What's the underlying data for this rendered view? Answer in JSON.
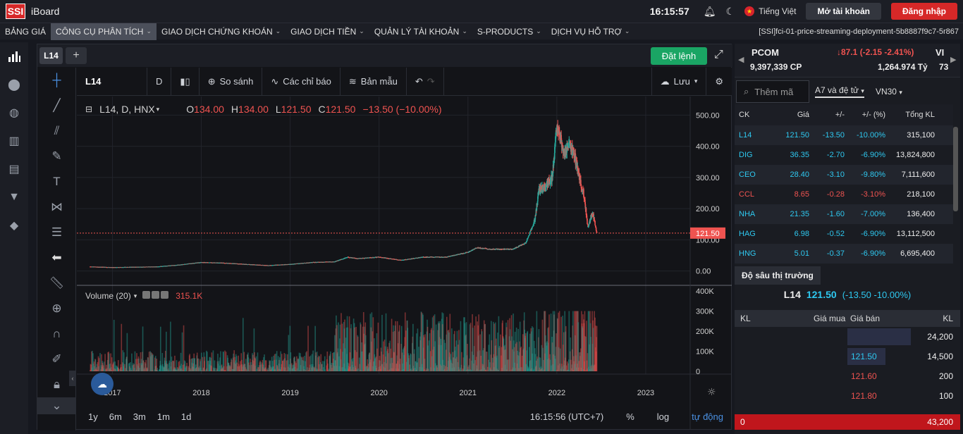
{
  "app": {
    "logo": "SSI",
    "name": "iBoard"
  },
  "header": {
    "time": "16:15:57",
    "language": "Tiếng Việt",
    "open_account": "Mở tài khoản",
    "login": "Đăng nhập"
  },
  "menu": {
    "items": [
      {
        "label": "BẢNG GIÁ",
        "chevron": false,
        "active": false
      },
      {
        "label": "CÔNG CỤ PHÂN TÍCH",
        "chevron": true,
        "active": true
      },
      {
        "label": "GIAO DỊCH CHỨNG KHOÁN",
        "chevron": true,
        "active": false
      },
      {
        "label": "GIAO DỊCH TIỀN",
        "chevron": true,
        "active": false
      },
      {
        "label": "QUẢN LÝ TÀI KHOẢN",
        "chevron": true,
        "active": false
      },
      {
        "label": "S-PRODUCTS",
        "chevron": true,
        "active": false
      },
      {
        "label": "DỊCH VỤ HỖ TRỢ",
        "chevron": true,
        "active": false
      }
    ],
    "deployment": "[SSI]fci-01-price-streaming-deployment-5b8887f9c7-5r867"
  },
  "chart_tab": {
    "symbol": "L14",
    "order_button": "Đặt lệnh"
  },
  "chart_toolbar": {
    "symbol": "L14",
    "interval": "D",
    "compare": "So sánh",
    "indicators": "Các chỉ báo",
    "templates": "Bản mẫu",
    "save": "Lưu"
  },
  "legend": {
    "title": "L14, D, HNX",
    "open_label": "O",
    "open": "134.00",
    "high_label": "H",
    "high": "134.00",
    "low_label": "L",
    "low": "121.50",
    "close_label": "C",
    "close": "121.50",
    "change": "−13.50 (−10.00%)"
  },
  "volume_legend": {
    "label": "Volume (20)",
    "value": "315.1K"
  },
  "bottom_bar": {
    "ranges": [
      "1y",
      "6m",
      "3m",
      "1m",
      "1d"
    ],
    "time": "16:15:56 (UTC+7)",
    "percent": "%",
    "log": "log",
    "auto": "tự động"
  },
  "colors": {
    "up": "#26a69a",
    "down": "#ef5350",
    "accent": "#1aa564",
    "brand": "#d62828",
    "blue": "#2ec8f0"
  },
  "chart_data": {
    "type": "candlestick",
    "symbol": "L14",
    "x_ticks": [
      "2017",
      "2018",
      "2019",
      "2020",
      "2021",
      "2022",
      "2023"
    ],
    "price_ticks": [
      "500.00",
      "400.00",
      "300.00",
      "200.00",
      "100.00",
      "0.00"
    ],
    "volume_ticks": [
      "400K",
      "300K",
      "200K",
      "100K",
      "0"
    ],
    "last_price": "121.50",
    "ylim": [
      -10,
      510
    ],
    "price_path": [
      [
        2016.75,
        14
      ],
      [
        2017.0,
        12
      ],
      [
        2017.5,
        14
      ],
      [
        2017.75,
        20
      ],
      [
        2018.0,
        28
      ],
      [
        2018.25,
        26
      ],
      [
        2018.5,
        22
      ],
      [
        2018.75,
        18
      ],
      [
        2019.0,
        22
      ],
      [
        2019.25,
        28
      ],
      [
        2019.5,
        30
      ],
      [
        2019.65,
        45
      ],
      [
        2019.75,
        40
      ],
      [
        2020.0,
        45
      ],
      [
        2020.25,
        35
      ],
      [
        2020.5,
        45
      ],
      [
        2020.75,
        45
      ],
      [
        2021.0,
        60
      ],
      [
        2021.1,
        75
      ],
      [
        2021.25,
        70
      ],
      [
        2021.5,
        70
      ],
      [
        2021.65,
        90
      ],
      [
        2021.75,
        160
      ],
      [
        2021.8,
        260
      ],
      [
        2021.9,
        280
      ],
      [
        2021.95,
        300
      ],
      [
        2022.0,
        470
      ],
      [
        2022.08,
        380
      ],
      [
        2022.15,
        400
      ],
      [
        2022.2,
        370
      ],
      [
        2022.25,
        300
      ],
      [
        2022.3,
        250
      ],
      [
        2022.35,
        140
      ],
      [
        2022.4,
        190
      ],
      [
        2022.45,
        121.5
      ]
    ],
    "volume_max": 400
  },
  "right_panel": {
    "ticker": {
      "name": "PCOM",
      "change": "↓87.1 (-2.15 -2.41%)",
      "volume": "9,397,339 CP",
      "value": "1,264.974 Tỷ",
      "name2": "VI",
      "value2": "73"
    },
    "search_placeholder": "Thêm mã",
    "tabs": [
      "A7 và đệ tử",
      "VN30"
    ],
    "watchlist_headers": [
      "CK",
      "Giá",
      "+/-",
      "+/- (%)",
      "Tổng KL"
    ],
    "watchlist": [
      {
        "sym": "L14",
        "price": "121.50",
        "chg": "-13.50",
        "pct": "-10.00%",
        "vol": "315,100",
        "color": "#2ec8f0"
      },
      {
        "sym": "DIG",
        "price": "36.35",
        "chg": "-2.70",
        "pct": "-6.90%",
        "vol": "13,824,800",
        "color": "#2ec8f0"
      },
      {
        "sym": "CEO",
        "price": "28.40",
        "chg": "-3.10",
        "pct": "-9.80%",
        "vol": "7,111,600",
        "color": "#2ec8f0"
      },
      {
        "sym": "CCL",
        "price": "8.65",
        "chg": "-0.28",
        "pct": "-3.10%",
        "vol": "218,100",
        "color": "#ef5350"
      },
      {
        "sym": "NHA",
        "price": "21.35",
        "chg": "-1.60",
        "pct": "-7.00%",
        "vol": "136,400",
        "color": "#2ec8f0"
      },
      {
        "sym": "HAG",
        "price": "6.98",
        "chg": "-0.52",
        "pct": "-6.90%",
        "vol": "13,112,500",
        "color": "#2ec8f0"
      },
      {
        "sym": "HNG",
        "price": "5.01",
        "chg": "-0.37",
        "pct": "-6.90%",
        "vol": "6,695,400",
        "color": "#2ec8f0"
      }
    ],
    "depth": {
      "title": "Độ sâu thị trường",
      "symbol": "L14",
      "price": "121.50",
      "change": "(-13.50 -10.00%)",
      "headers": {
        "kl": "KL",
        "bid": "Giá mua",
        "ask": "Giá bán",
        "kl2": "KL"
      },
      "rows": [
        {
          "ask": "",
          "kl": "24,200",
          "fill": 0.3,
          "color": "#eee"
        },
        {
          "ask": "121.50",
          "kl": "14,500",
          "fill": 0.18,
          "color": "#2ec8f0"
        },
        {
          "ask": "121.60",
          "kl": "200",
          "fill": 0,
          "color": "#ef5350"
        },
        {
          "ask": "121.80",
          "kl": "100",
          "fill": 0,
          "color": "#ef5350"
        }
      ],
      "footer_left": "0",
      "footer_right": "43,200"
    }
  }
}
